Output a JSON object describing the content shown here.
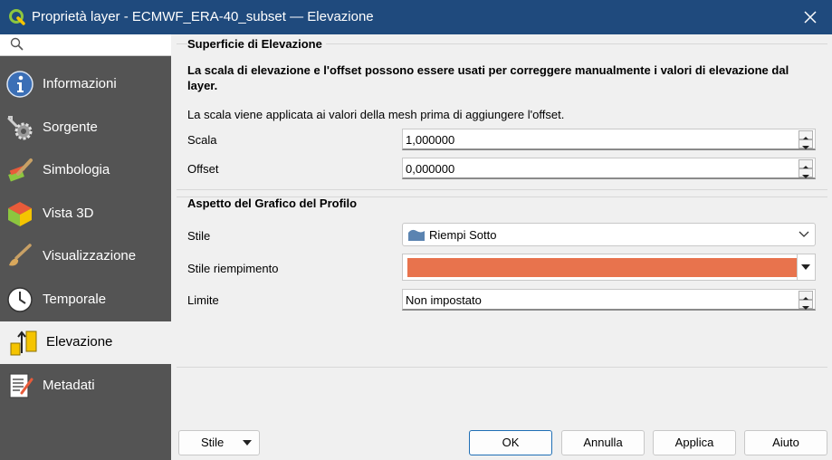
{
  "window": {
    "title": "Proprietà layer - ECMWF_ERA-40_subset — Elevazione"
  },
  "sidebar": {
    "search_icon": "search-icon",
    "items": [
      {
        "label": "Informazioni",
        "icon": "info-icon"
      },
      {
        "label": "Sorgente",
        "icon": "source-gear-icon"
      },
      {
        "label": "Simbologia",
        "icon": "paint-brush-icon"
      },
      {
        "label": "Vista 3D",
        "icon": "cube-3d-icon"
      },
      {
        "label": "Visualizzazione",
        "icon": "brush-icon"
      },
      {
        "label": "Temporale",
        "icon": "clock-icon"
      },
      {
        "label": "Elevazione",
        "icon": "elevation-icon"
      },
      {
        "label": "Metadati",
        "icon": "metadata-icon"
      }
    ],
    "active_index": 6
  },
  "elevation": {
    "title": "Superficie di Elevazione",
    "description": "La scala di elevazione e l'offset possono essere usati per correggere manualmente i valori di elevazione dal layer.",
    "note": "La scala viene applicata ai valori della mesh prima di aggiungere l'offset.",
    "scale_label": "Scala",
    "scale_value": "1,000000",
    "offset_label": "Offset",
    "offset_value": "0,000000"
  },
  "profile": {
    "title": "Aspetto del Grafico del Profilo",
    "style_label": "Stile",
    "style_value": "Riempi Sotto",
    "fill_style_label": "Stile riempimento",
    "fill_color": "#e8734d",
    "limit_label": "Limite",
    "limit_value": "Non impostato"
  },
  "buttons": {
    "style": "Stile",
    "ok": "OK",
    "cancel": "Annulla",
    "apply": "Applica",
    "help": "Aiuto"
  },
  "colors": {
    "titlebar": "#1f4a7d",
    "sidebar": "#545454",
    "accent": "#1f6fb5"
  }
}
